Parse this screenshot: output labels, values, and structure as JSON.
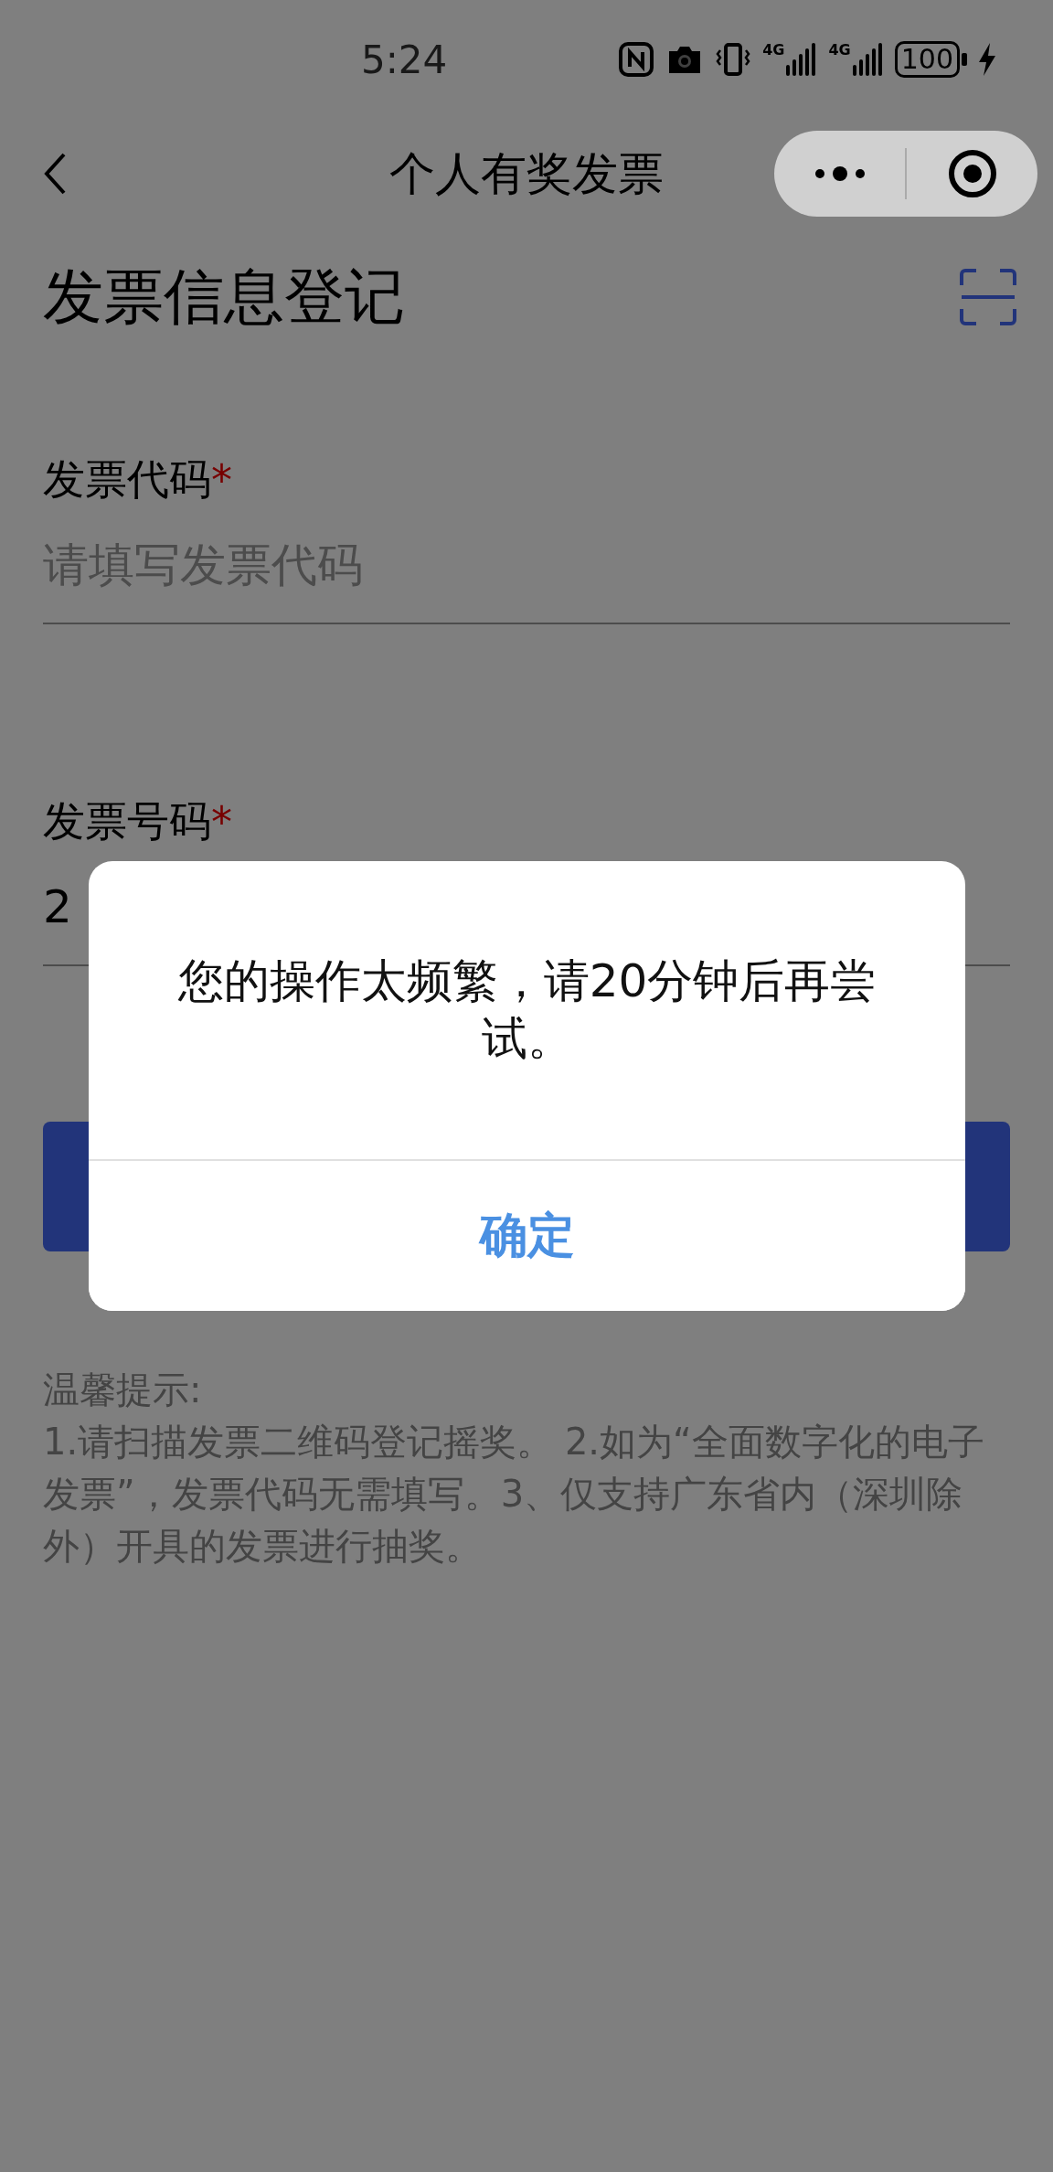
{
  "status_bar": {
    "time": "5:24",
    "networks": [
      "4G",
      "4G"
    ],
    "battery": "100"
  },
  "nav": {
    "title": "个人有奖发票"
  },
  "header": {
    "title": "发票信息登记"
  },
  "fields": [
    {
      "label": "发票代码",
      "required_mark": "*",
      "placeholder": "请填写发票代码"
    },
    {
      "label": "发票号码",
      "required_mark": "*",
      "value": "2"
    }
  ],
  "tips": {
    "title": "温馨提示:",
    "body": "1.请扫描发票二维码登记摇奖。 2.如为“全面数字化的电子发票”，发票代码无需填写。3、仅支持广东省内（深圳除外）开具的发票进行抽奖。"
  },
  "dialog": {
    "message": "您的操作太频繁，请20分钟后再尝试。",
    "button": "确定"
  }
}
